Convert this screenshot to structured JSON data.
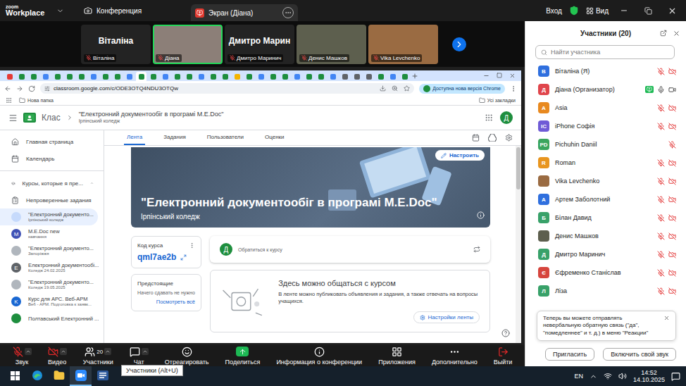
{
  "zoom": {
    "app_sub": "zoom",
    "app_name": "Workplace",
    "meeting_tab": "Конференция",
    "screen_tab": "Экран (Діана)",
    "signin": "Вход",
    "view": "Вид"
  },
  "video_tiles": [
    {
      "kind": "name",
      "big_name": "Віталіна",
      "label": "Віталіна",
      "mic_muted": true,
      "active": false,
      "color": "#232323"
    },
    {
      "kind": "photo",
      "big_name": "",
      "label": "Діана",
      "mic_muted": true,
      "active": true,
      "color": "#8c7f78"
    },
    {
      "kind": "name",
      "big_name": "Дмитро Марин",
      "label": "Дмитро Маринич",
      "mic_muted": true,
      "active": false,
      "color": "#232323"
    },
    {
      "kind": "photo",
      "big_name": "",
      "label": "Денис Машков",
      "mic_muted": true,
      "active": false,
      "color": "#5d5f4e"
    },
    {
      "kind": "photo",
      "big_name": "",
      "label": "Vika Levchenko",
      "mic_muted": true,
      "active": false,
      "color": "#9a6b42"
    }
  ],
  "browser": {
    "tabs": [
      {
        "color": "#e53935",
        "selected": false
      },
      {
        "color": "#1e8e3e",
        "selected": false
      },
      {
        "color": "#1e8e3e",
        "selected": false
      },
      {
        "color": "#4285f4",
        "selected": false
      },
      {
        "color": "#1e8e3e",
        "selected": false
      },
      {
        "color": "#1e8e3e",
        "selected": false
      },
      {
        "color": "#1e8e3e",
        "selected": false
      },
      {
        "color": "#4285f4",
        "selected": false
      },
      {
        "color": "#1e8e3e",
        "selected": false
      },
      {
        "color": "#1e8e3e",
        "selected": false
      },
      {
        "color": "#4285f4",
        "selected": false
      },
      {
        "color": "#1e8e3e",
        "selected": true
      },
      {
        "color": "#1e8e3e",
        "selected": false
      },
      {
        "color": "#4285f4",
        "selected": false
      },
      {
        "color": "#1e8e3e",
        "selected": false
      },
      {
        "color": "#1e8e3e",
        "selected": false
      },
      {
        "color": "#4285f4",
        "selected": false
      },
      {
        "color": "#1e8e3e",
        "selected": false
      },
      {
        "color": "#1e8e3e",
        "selected": false
      },
      {
        "color": "#f4b400",
        "selected": false
      },
      {
        "color": "#1e8e3e",
        "selected": false
      },
      {
        "color": "#4285f4",
        "selected": false
      },
      {
        "color": "#1e8e3e",
        "selected": false
      },
      {
        "color": "#1e8e3e",
        "selected": false
      },
      {
        "color": "#4285f4",
        "selected": false
      },
      {
        "color": "#1e8e3e",
        "selected": false
      },
      {
        "color": "#1e8e3e",
        "selected": false
      },
      {
        "color": "#4285f4",
        "selected": false
      },
      {
        "color": "#5f6368",
        "selected": false
      },
      {
        "color": "#5f6368",
        "selected": false
      },
      {
        "color": "#5f6368",
        "selected": false
      },
      {
        "color": "#1e8e3e",
        "selected": false
      },
      {
        "color": "#4285f4",
        "selected": false
      },
      {
        "color": "#1e8e3e",
        "selected": false
      }
    ],
    "url": "classroom.google.com/c/ODE3OTQ4NDU3OTQw",
    "update_notice": "Доступна нова версія Chrome",
    "bookmark_folder": "Нова папка",
    "all_bookmarks": "Усі закладки"
  },
  "classroom": {
    "logo": "Клас",
    "course_title": "\"Електронний документообіг в програмі M.E.Doc\"",
    "course_subtitle": "Ірпінський коледж",
    "avatar": "Д",
    "nav_tabs": [
      {
        "label": "Лента",
        "selected": true
      },
      {
        "label": "Задания",
        "selected": false
      },
      {
        "label": "Пользователи",
        "selected": false
      },
      {
        "label": "Оценки",
        "selected": false
      }
    ],
    "sidebar": {
      "items": [
        {
          "label": "Главная страница",
          "kind": "home"
        },
        {
          "label": "Календарь",
          "kind": "calendar"
        }
      ],
      "section": {
        "label": "Курсы, которые я пре...",
        "expanded": true
      },
      "todo": "Непроверенные задания",
      "courses": [
        {
          "title": "\"Електронний документо...",
          "subtitle": "Ірпінський коледж",
          "color": "#c6dafc",
          "selected": true
        },
        {
          "title": "M.E.Doc new",
          "subtitle": "навчання",
          "initial": "M",
          "color": "#3f51b5",
          "selected": false
        },
        {
          "title": "\"Електронний документо...",
          "subtitle": "Запоріжжя",
          "color": "#b0b6bd",
          "selected": false
        },
        {
          "title": "Електронний документообі...",
          "subtitle": "Коледж 24.02.2025",
          "initial": "E",
          "color": "#5f6368",
          "selected": false
        },
        {
          "title": "\"Електронний документо...",
          "subtitle": "Коледж 19.05.2025",
          "color": "#b0b6bd",
          "selected": false
        },
        {
          "title": "Курс для АРС. Веб-АРМ",
          "subtitle": "Веб - АРМ. Подготовка к заявк...",
          "initial": "K",
          "color": "#1967d2",
          "selected": false
        },
        {
          "title": "Полтавський Електронний ...",
          "color": "#1e8e3e",
          "selected": false
        }
      ]
    },
    "banner": {
      "title": "\"Електронний документообіг в програмі M.E.Doc\"",
      "subtitle": "Ірпінський коледж",
      "customize": "Настроить"
    },
    "code_card": {
      "label": "Код курса",
      "code": "qml7ae2b"
    },
    "upcoming": {
      "title": "Предстоящие",
      "text": "Начего сдавать не нужно",
      "link": "Посмотреть всё"
    },
    "post_box": {
      "avatar": "Д",
      "placeholder": "Обратиться к курсу"
    },
    "empty_feed": {
      "title": "Здесь можно общаться с курсом",
      "text": "В ленте можно публиковать объявления и задания, а также отвечать на вопросы учащихся.",
      "button": "Настройки ленты"
    }
  },
  "toolbar": {
    "items": [
      {
        "label": "Звук",
        "kind": "mic",
        "alert": true,
        "caret": true,
        "count": ""
      },
      {
        "label": "Видео",
        "kind": "video",
        "alert": true,
        "caret": true,
        "count": ""
      },
      {
        "label": "Участники",
        "kind": "participants",
        "alert": false,
        "caret": true,
        "count": "20"
      },
      {
        "label": "Чат",
        "kind": "chat",
        "alert": false,
        "caret": true,
        "count": ""
      },
      {
        "label": "Отреагировать",
        "kind": "react",
        "alert": false,
        "caret": false,
        "count": ""
      },
      {
        "label": "Поделиться",
        "kind": "share",
        "alert": false,
        "caret": false,
        "count": ""
      },
      {
        "label": "Информация о конференции",
        "kind": "info",
        "alert": false,
        "caret": false,
        "count": ""
      },
      {
        "label": "Приложения",
        "kind": "apps",
        "alert": false,
        "caret": false,
        "count": ""
      },
      {
        "label": "Дополнительно",
        "kind": "more",
        "alert": false,
        "caret": false,
        "count": ""
      },
      {
        "label": "Выйти",
        "kind": "leave",
        "alert": true,
        "caret": false,
        "count": ""
      }
    ],
    "tooltip": "Участники (Alt+U)"
  },
  "participants": {
    "title": "Участники (20)",
    "search_placeholder": "Найти участника",
    "list": [
      {
        "name": "Віталіна (Я)",
        "kind": "letter",
        "initials": "В",
        "color": "#2f6fde",
        "sharing": false,
        "mic_muted": true,
        "video_icon": true,
        "video_off": true
      },
      {
        "name": "Діана (Организатор)",
        "kind": "letter",
        "initials": "Д",
        "color": "#e0454b",
        "sharing": true,
        "mic_muted": false,
        "video_icon": true,
        "video_off": false
      },
      {
        "name": "Asia",
        "kind": "letter",
        "initials": "A",
        "color": "#e8891f",
        "sharing": false,
        "mic_muted": true,
        "video_icon": true,
        "video_off": true
      },
      {
        "name": "iPhone Софія",
        "kind": "letter",
        "initials": "IC",
        "color": "#6f5bd6",
        "sharing": false,
        "mic_muted": true,
        "video_icon": true,
        "video_off": true
      },
      {
        "name": "Pichuhin Daniil",
        "kind": "letter",
        "initials": "PD",
        "color": "#3aa55d",
        "sharing": false,
        "mic_muted": true,
        "video_icon": false,
        "video_off": true
      },
      {
        "name": "Roman",
        "kind": "letter",
        "initials": "R",
        "color": "#e8951f",
        "sharing": false,
        "mic_muted": true,
        "video_icon": true,
        "video_off": true
      },
      {
        "name": "Vika Levchenko",
        "kind": "photo",
        "initials": "",
        "color": "#9a6b42",
        "sharing": false,
        "mic_muted": true,
        "video_icon": true,
        "video_off": true
      },
      {
        "name": "Артем Заболотний",
        "kind": "letter",
        "initials": "А",
        "color": "#2f6fde",
        "sharing": false,
        "mic_muted": true,
        "video_icon": true,
        "video_off": true
      },
      {
        "name": "Білан Давид",
        "kind": "letter",
        "initials": "Б",
        "color": "#38a169",
        "sharing": false,
        "mic_muted": true,
        "video_icon": true,
        "video_off": true
      },
      {
        "name": "Денис Машков",
        "kind": "photo",
        "initials": "",
        "color": "#5d5f4e",
        "sharing": false,
        "mic_muted": true,
        "video_icon": true,
        "video_off": true
      },
      {
        "name": "Дмитро Маринич",
        "kind": "letter",
        "initials": "Д",
        "color": "#38a169",
        "sharing": false,
        "mic_muted": true,
        "video_icon": true,
        "video_off": true
      },
      {
        "name": "Єфременко Станіслав",
        "kind": "letter",
        "initials": "Є",
        "color": "#d6453d",
        "sharing": false,
        "mic_muted": true,
        "video_icon": true,
        "video_off": true
      },
      {
        "name": "Ліза",
        "kind": "letter",
        "initials": "Л",
        "color": "#38a169",
        "sharing": false,
        "mic_muted": true,
        "video_icon": true,
        "video_off": true
      }
    ],
    "notice": "Теперь вы можете отправлять невербальную обратную связь (\"да\", \"помедленнее\" и т. д.) в меню \"Реакции\"",
    "invite": "Пригласить",
    "unmute": "Включить свой звук"
  },
  "taskbar": {
    "apps": [
      {
        "kind": "start",
        "active": false
      },
      {
        "kind": "edge",
        "active": false
      },
      {
        "kind": "explorer",
        "active": false
      },
      {
        "kind": "zoom",
        "active": true
      },
      {
        "kind": "word",
        "active": false
      }
    ],
    "language": "EN",
    "time": "14:52",
    "date": "14.10.2025"
  }
}
